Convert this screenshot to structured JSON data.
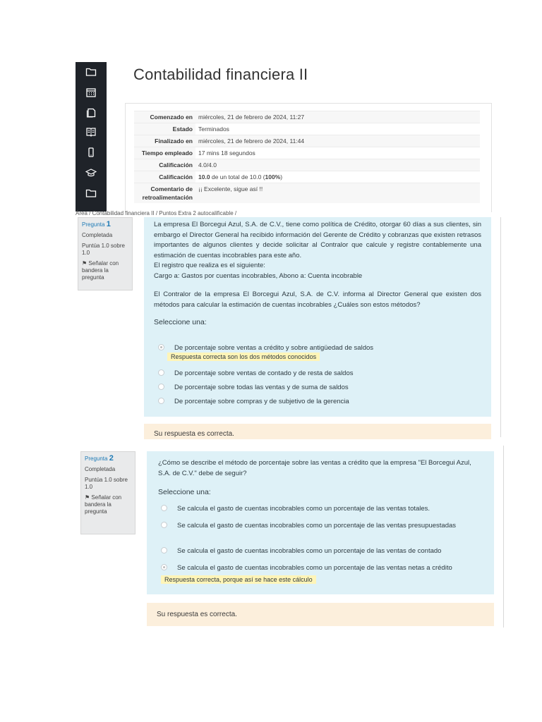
{
  "course_title": "Contabilidad financiera II",
  "sidebar_icons": [
    "folder-icon",
    "calendar-icon",
    "copy-icon",
    "book-icon",
    "phone-icon",
    "graduation-cap-icon",
    "folder-icon"
  ],
  "summary": [
    {
      "key": "Comenzado en",
      "value": "miércoles, 21 de febrero de 2024, 11:27"
    },
    {
      "key": "Estado",
      "value": "Terminados"
    },
    {
      "key": "Finalizado en",
      "value": "miércoles, 21 de febrero de 2024, 11:44"
    },
    {
      "key": "Tiempo empleado",
      "value": "17 mins 18 segundos"
    },
    {
      "key": "Calificación",
      "value": "4.0/4.0"
    },
    {
      "key": "Calificación",
      "value_bold": "10.0",
      "value_rest": " de un total de 10.0 (",
      "value_pct": "100%",
      "value_end": ")"
    },
    {
      "key": "Comentario de retroalimentación",
      "value": "¡¡ Excelente, sigue así !!"
    }
  ],
  "breadcrumb": "Área  /  Contabilidad financiera II  /  Puntos Extra 2 autocalificable  /",
  "q1": {
    "label": "Pregunta",
    "number": "1",
    "state": "Completada",
    "score": "Puntúa 1.0 sobre 1.0",
    "flag": "Señalar con bandera la pregunta",
    "text1": "La empresa El Borcegui Azul, S.A. de C.V., tiene como política de Crédito, otorgar 60 días a sus clientes, sin embargo el Director General ha recibido información del Gerente de Crédito y cobranzas que existen retrasos importantes de algunos clientes y decide solicitar al Contralor que calcule y registre contablemente una estimación de cuentas incobrables para este año.",
    "text2": "El registro que realiza es el siguiente:",
    "text3": "Cargo a: Gastos por cuentas incobrables, Abono a: Cuenta incobrable",
    "text4": "El Contralor de la empresa El Borcegui Azul, S.A. de C.V.  informa al Director General que existen dos métodos para calcular la estimación de cuentas incobrables ¿Cuáles son estos métodos?",
    "prompt": "Seleccione una:",
    "options": [
      "De porcentaje sobre ventas a crédito y sobre antigüedad de saldos",
      "De porcentaje sobre ventas de contado y de resta de saldos",
      "De porcentaje sobre todas las ventas y de suma de saldos",
      "De porcentaje sobre compras y de subjetivo de la gerencia"
    ],
    "selected_index": 0,
    "option_feedback": "Respuesta correcta son los dos métodos conocidos",
    "feedback": "Su respuesta es correcta."
  },
  "q2": {
    "label": "Pregunta",
    "number": "2",
    "state": "Completada",
    "score": "Puntúa 1.0 sobre 1.0",
    "flag": "Señalar con bandera la pregunta",
    "text": "¿Cómo se describe el método de porcentaje sobre las ventas a crédito que la empresa \"El Borcegui Azul, S.A. de C.V.\" debe de seguir?",
    "prompt": "Seleccione una:",
    "options": [
      "Se calcula el gasto de cuentas incobrables como un porcentaje de las ventas totales.",
      "Se calcula el gasto de cuentas incobrables como un porcentaje de las ventas presupuestadas",
      "Se calcula el gasto de cuentas incobrables como un porcentaje de las ventas de contado",
      "Se calcula el gasto de cuentas incobrables como un porcentaje de las ventas netas a crédito"
    ],
    "selected_index": 3,
    "option_feedback": "Respuesta correcta, porque así se hace este cálculo",
    "feedback": "Su respuesta es correcta."
  },
  "colors": {
    "sidebar": "#1f2329",
    "question_bg": "#def1f7",
    "feedback_bg": "#fcefdc",
    "highlight": "#fff5b8",
    "link": "#1f7bb6"
  }
}
